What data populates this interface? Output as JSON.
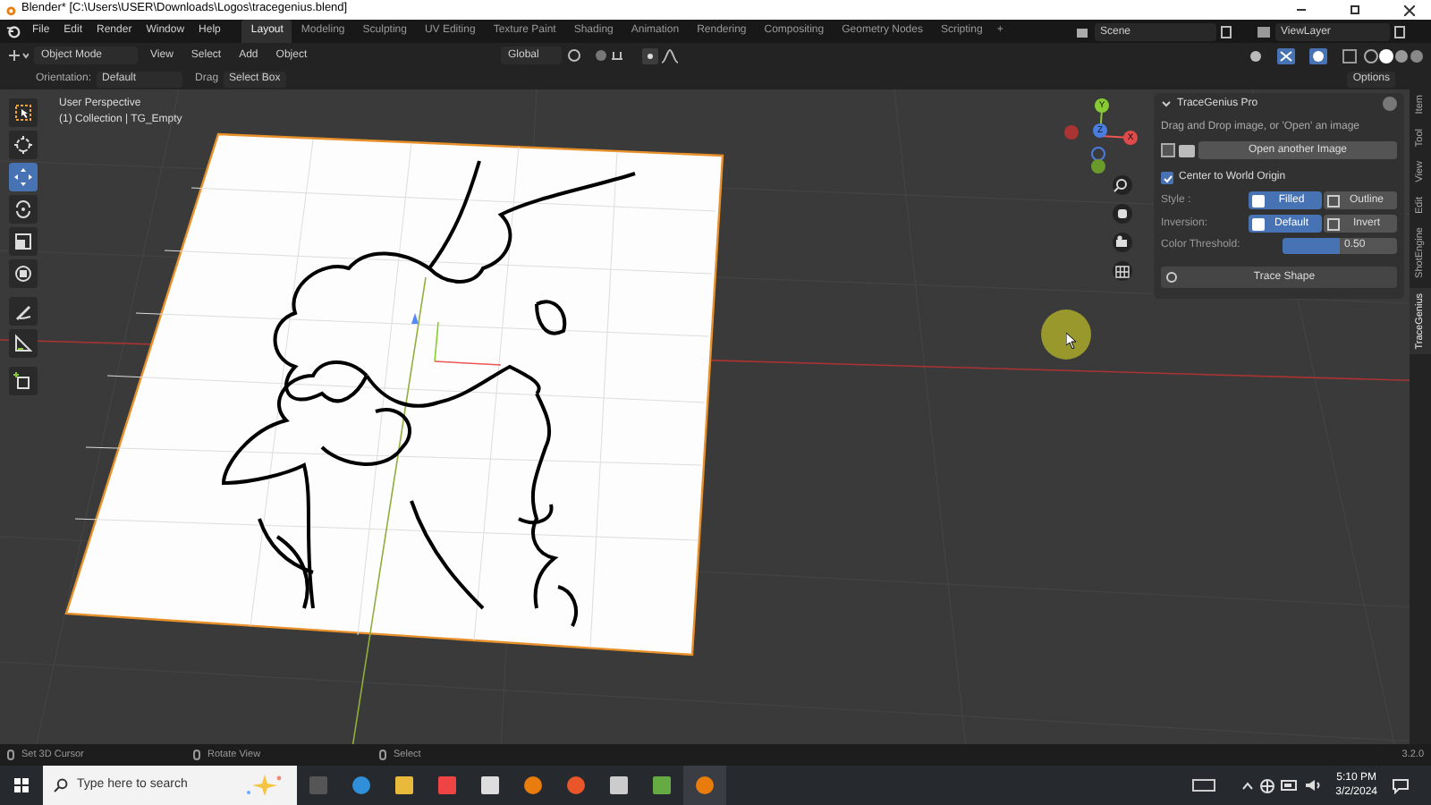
{
  "window": {
    "title": "Blender* [C:\\Users\\USER\\Downloads\\Logos\\tracegenius.blend]"
  },
  "topbar": {
    "menus": [
      "File",
      "Edit",
      "Render",
      "Window",
      "Help"
    ],
    "workspaces": [
      {
        "label": "Layout",
        "selected": true
      },
      {
        "label": "Modeling",
        "selected": false
      },
      {
        "label": "Sculpting",
        "selected": false
      },
      {
        "label": "UV Editing",
        "selected": false
      },
      {
        "label": "Texture Paint",
        "selected": false
      },
      {
        "label": "Shading",
        "selected": false
      },
      {
        "label": "Animation",
        "selected": false
      },
      {
        "label": "Rendering",
        "selected": false
      },
      {
        "label": "Compositing",
        "selected": false
      },
      {
        "label": "Geometry Nodes",
        "selected": false
      },
      {
        "label": "Scripting",
        "selected": false
      }
    ],
    "add_tab": "+",
    "scene": "Scene",
    "view_layer": "ViewLayer"
  },
  "header": {
    "mode": "Object Mode",
    "menus": [
      "View",
      "Select",
      "Add",
      "Object"
    ],
    "transform": "Global"
  },
  "tool_settings": {
    "orientation_label": "Orientation:",
    "orientation": "Default",
    "drag_label": "Drag",
    "drag": "Select Box",
    "options": "Options"
  },
  "viewport": {
    "info": [
      "User Perspective",
      "(1) Collection | TG_Empty"
    ],
    "tools": [
      {
        "kind": "select",
        "selected": false
      },
      {
        "kind": "cursor",
        "selected": false
      },
      {
        "kind": "move",
        "selected": true
      },
      {
        "kind": "rotate",
        "selected": false
      },
      {
        "kind": "scale",
        "selected": false
      },
      {
        "kind": "transform",
        "selected": false
      },
      {
        "kind": "annotate",
        "selected": false
      },
      {
        "kind": "measure",
        "selected": false
      },
      {
        "kind": "add",
        "selected": false
      }
    ],
    "gizmo": {
      "x": "X",
      "y": "Y",
      "z": "Z"
    }
  },
  "panel": {
    "title": "TraceGenius Pro",
    "hint": "Drag and Drop image, or 'Open' an image",
    "open_button": "Open another Image",
    "center": {
      "label": "Center to World Origin",
      "checked": true
    },
    "style": {
      "label": "Style :",
      "options": [
        {
          "label": "Filled",
          "selected": true
        },
        {
          "label": "Outline",
          "selected": false
        }
      ]
    },
    "inversion": {
      "label": "Inversion:",
      "options": [
        {
          "label": "Default",
          "selected": true
        },
        {
          "label": "Invert",
          "selected": false
        }
      ]
    },
    "threshold": {
      "label": "Color Threshold:",
      "reading": "0.50",
      "level": 0.5
    },
    "trace_button": "Trace Shape"
  },
  "side_tabs": [
    {
      "label": "Item",
      "selected": false
    },
    {
      "label": "Tool",
      "selected": false
    },
    {
      "label": "View",
      "selected": false
    },
    {
      "label": "Edit",
      "selected": false
    },
    {
      "label": "ShotEngine",
      "selected": false
    },
    {
      "label": "TraceGenius",
      "selected": true
    }
  ],
  "status_bar": {
    "hints": [
      "Set 3D Cursor",
      "Rotate View",
      "Select"
    ],
    "version": "3.2.0"
  },
  "taskbar": {
    "search_placeholder": "Type here to search",
    "time": "5:10 PM",
    "date": "3/2/2024"
  }
}
